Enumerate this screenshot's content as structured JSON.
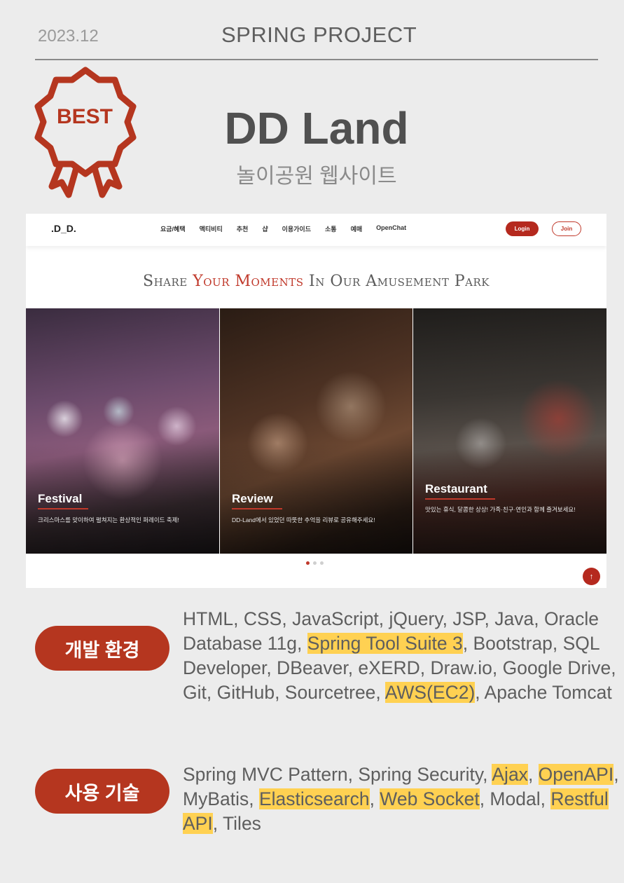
{
  "header": {
    "date": "2023.12",
    "kicker": "SPRING PROJECT",
    "badge_text": "BEST",
    "title": "DD Land",
    "subtitle": "놀이공원 웹사이트"
  },
  "colors": {
    "accent": "#b5361f",
    "highlight": "#ffd152",
    "background": "#ececec"
  },
  "screenshot": {
    "logo": ".D_D.",
    "menu": [
      "요금/혜택",
      "액티비티",
      "추천",
      "샵",
      "이용가이드",
      "소통",
      "예매",
      "OpenChat"
    ],
    "login_label": "Login",
    "join_label": "Join",
    "tagline_pre": "Share ",
    "tagline_accent": "Your Moments",
    "tagline_post": " In Our Amusement Park",
    "panels": [
      {
        "title": "Festival",
        "desc": "크리스마스를 맞이하여 펼쳐지는 환상적인 퍼레이드 축제!"
      },
      {
        "title": "Review",
        "desc": "DD-Land에서 있었던 따뜻한 추억을 리뷰로 공유해주세요!"
      },
      {
        "title": "Restaurant",
        "desc": "맛있는 휴식, 달콤한 상상! 가족·친구·연인과 함께 즐겨보세요!"
      }
    ],
    "slides_total": 3,
    "slides_active": 1,
    "top_icon": "arrow-up-icon"
  },
  "sections": {
    "dev_label": "개발 환경",
    "tech_label": "사용 기술",
    "dev_items": [
      {
        "text": "HTML, CSS, JavaScript, jQuery, JSP, Java,",
        "hl": false
      },
      {
        "text": " Oracle Database 11g, ",
        "hl": false
      },
      {
        "text": "Spring Tool Suite 3",
        "hl": true
      },
      {
        "text": ", Bootstrap, SQL Developer, DBeaver, eXERD, Draw.io, Google Drive, Git, GitHub, Sourcetree, ",
        "hl": false
      },
      {
        "text": "AWS(EC2)",
        "hl": true
      },
      {
        "text": ", Apache Tomcat",
        "hl": false
      }
    ],
    "tech_items": [
      {
        "text": "Spring MVC Pattern, Spring Security, ",
        "hl": false
      },
      {
        "text": "Ajax",
        "hl": true
      },
      {
        "text": ", ",
        "hl": false
      },
      {
        "text": "OpenAPI",
        "hl": true
      },
      {
        "text": ", MyBatis, ",
        "hl": false
      },
      {
        "text": "Elasticsearch",
        "hl": true
      },
      {
        "text": ", ",
        "hl": false
      },
      {
        "text": "Web Socket",
        "hl": true
      },
      {
        "text": ", Modal, ",
        "hl": false
      },
      {
        "text": "Restful API",
        "hl": true
      },
      {
        "text": ", Tiles",
        "hl": false
      }
    ]
  }
}
